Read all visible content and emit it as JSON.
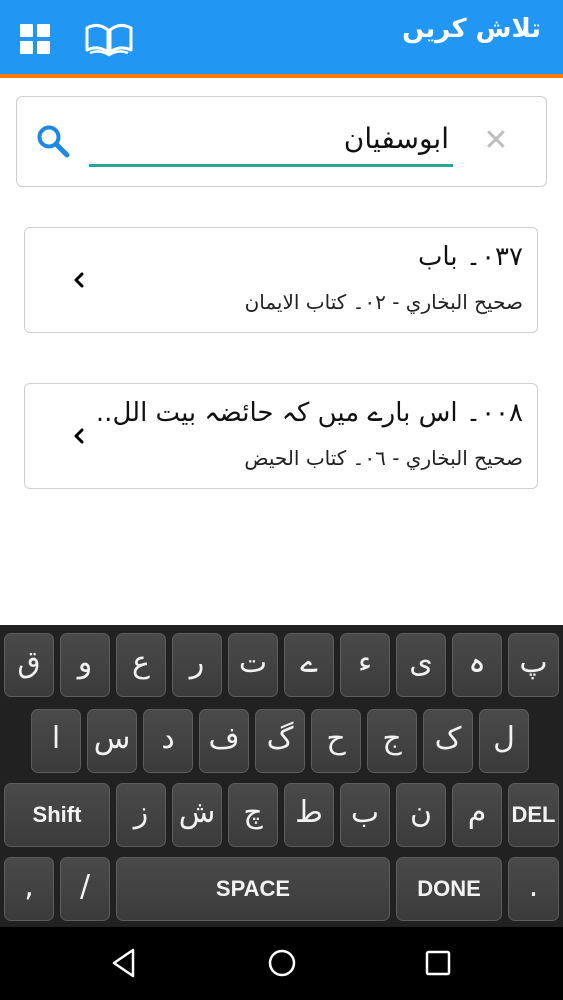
{
  "app_bar": {
    "title": "تلاش کریں"
  },
  "search": {
    "value": "ابوسفیان"
  },
  "results": [
    {
      "title": "٠٣٧۔ باب",
      "subtitle": "صحیح البخاري - ٠٢۔ کتاب الایمان"
    },
    {
      "title": "٠٠٨۔  اس بارے میں کہ حائضہ بیت الل..",
      "subtitle": "صحیح البخاري - ٠٦۔ کتاب الحیض"
    }
  ],
  "keyboard": {
    "row1": [
      "ق",
      "و",
      "ع",
      "ر",
      "ت",
      "ے",
      "ء",
      "ی",
      "ہ",
      "پ"
    ],
    "row2": [
      "ا",
      "س",
      "د",
      "ف",
      "گ",
      "ح",
      "ج",
      "ک",
      "ل"
    ],
    "row3": [
      "Shift",
      "ز",
      "ش",
      "چ",
      "ط",
      "ب",
      "ن",
      "م",
      "DEL"
    ],
    "row4": [
      ",",
      "/",
      "SPACE",
      "DONE",
      "."
    ]
  },
  "colors": {
    "appbar": "#2196f3",
    "accent_line": "#ff7a00",
    "input_underline": "#26a69a"
  }
}
